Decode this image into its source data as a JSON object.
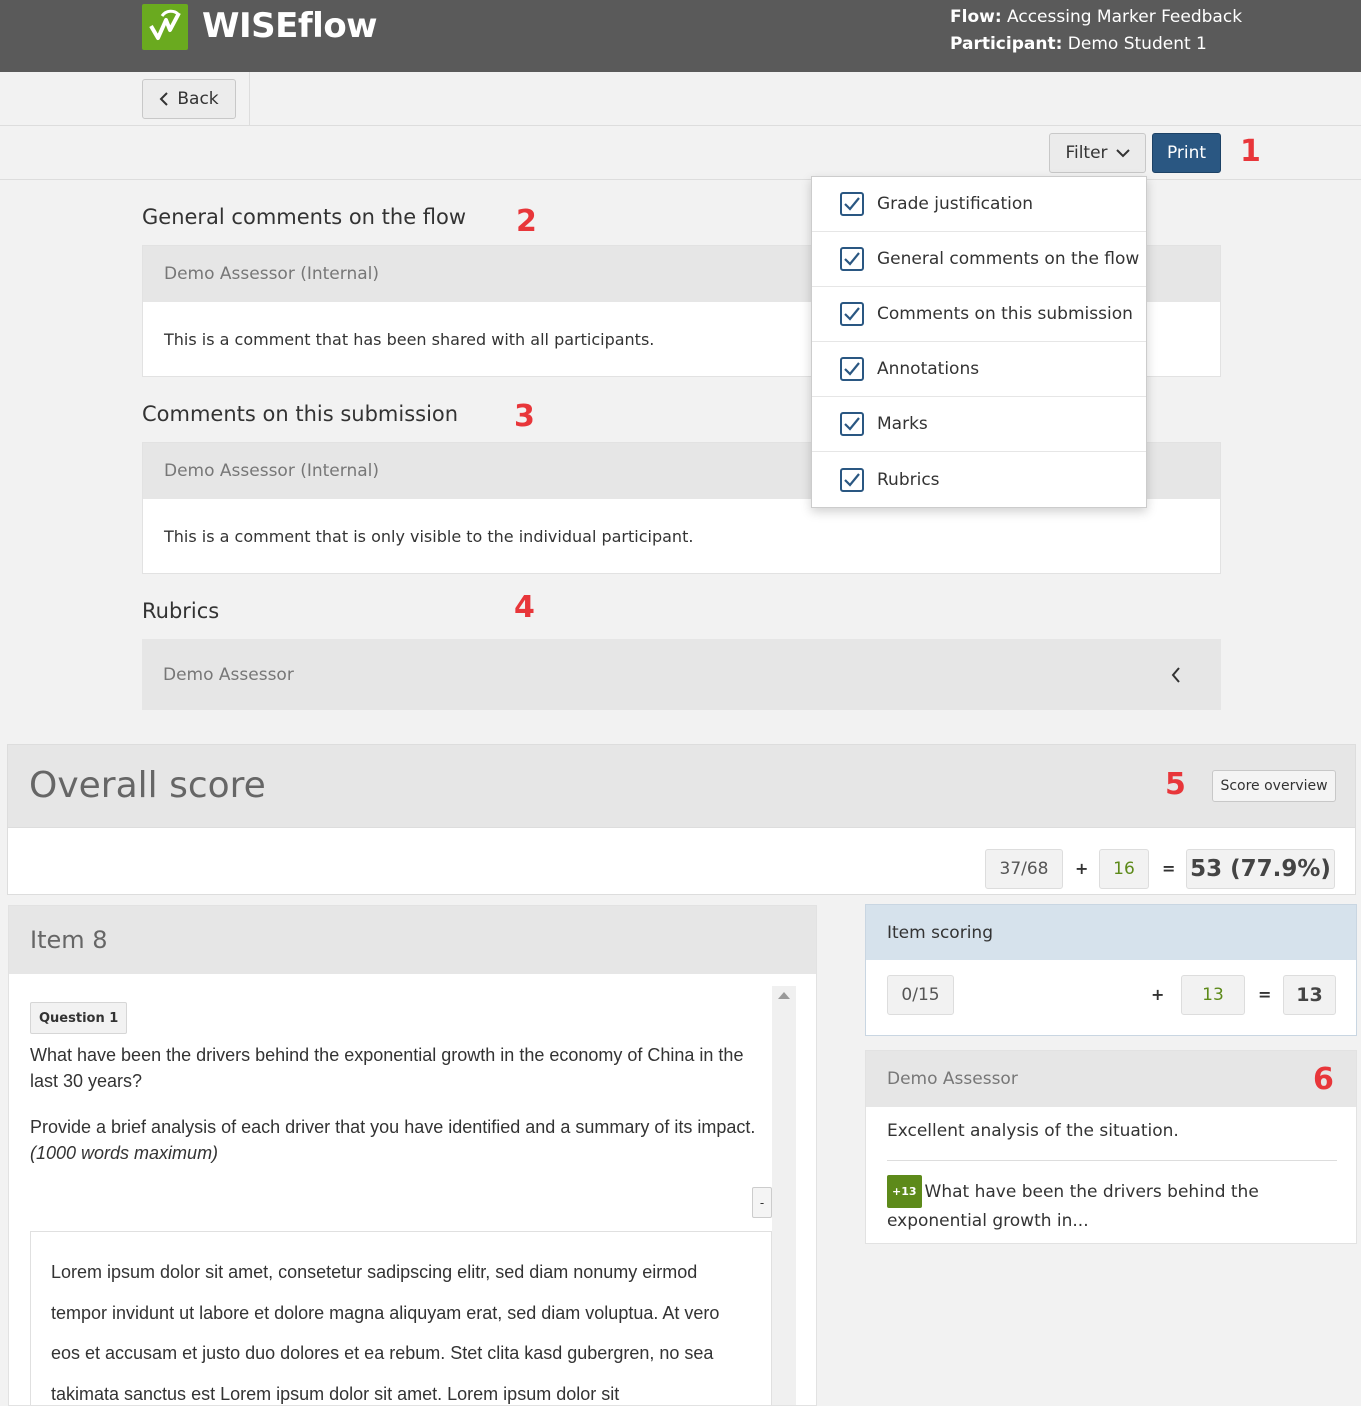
{
  "header": {
    "logo_text": "WISEflow",
    "flow_label": "Flow:",
    "flow_value": "Accessing Marker Feedback",
    "participant_label": "Participant:",
    "participant_value": "Demo Student 1"
  },
  "nav": {
    "back_label": "Back"
  },
  "toolbar": {
    "filter_label": "Filter",
    "print_label": "Print"
  },
  "callouts": [
    "1",
    "2",
    "3",
    "4",
    "5",
    "6"
  ],
  "filter_menu": {
    "items": [
      {
        "label": "Grade justification",
        "checked": true
      },
      {
        "label": "General comments on the flow",
        "checked": true
      },
      {
        "label": "Comments on this submission",
        "checked": true
      },
      {
        "label": "Annotations",
        "checked": true
      },
      {
        "label": "Marks",
        "checked": true
      },
      {
        "label": "Rubrics",
        "checked": true
      }
    ]
  },
  "general_comments": {
    "title": "General comments on the flow",
    "assessor": "Demo Assessor (Internal)",
    "comment": "This is a comment that has been shared with all participants."
  },
  "submission_comments": {
    "title": "Comments on this submission",
    "assessor": "Demo Assessor (Internal)",
    "comment": "This is a comment that is only visible to the individual participant."
  },
  "rubrics": {
    "title": "Rubrics",
    "assessor": "Demo Assessor"
  },
  "overall": {
    "title": "Overall score",
    "score_overview_label": "Score overview",
    "auto_score": "37/68",
    "plus": "+",
    "manual_score": "16",
    "equals": "=",
    "total": "53 (77.9%)"
  },
  "item": {
    "title": "Item 8",
    "question_badge": "Question 1",
    "question_line1": "What have been the drivers behind the exponential growth in the economy of China in the last 30 years?",
    "question_line2": "Provide a brief analysis of each driver that you have identified and a summary of its impact.",
    "question_note": "(1000 words maximum)",
    "collapse_label": "-",
    "answer": "Lorem ipsum dolor sit amet, consetetur sadipscing elitr, sed diam nonumy eirmod tempor invidunt ut labore et dolore magna aliquyam erat, sed diam voluptua. At vero eos et accusam et justo duo dolores et ea rebum. Stet clita kasd gubergren, no sea takimata sanctus est Lorem ipsum dolor sit amet. Lorem ipsum dolor sit"
  },
  "item_scoring": {
    "title": "Item scoring",
    "auto_score": "0/15",
    "plus": "+",
    "manual_score": "13",
    "equals": "=",
    "total": "13"
  },
  "assessor_feedback": {
    "assessor": "Demo Assessor",
    "comment": "Excellent analysis of the situation.",
    "badge": "+13",
    "link_text": "What have been the drivers behind the exponential growth in..."
  },
  "colors": {
    "header_bg": "#5a5a5a",
    "logo_green": "#6aaa1f",
    "print_blue": "#2a5782",
    "callout_red": "#e8363a",
    "score_green": "#5d8a1a",
    "scoring_header": "#d6e2ec"
  }
}
